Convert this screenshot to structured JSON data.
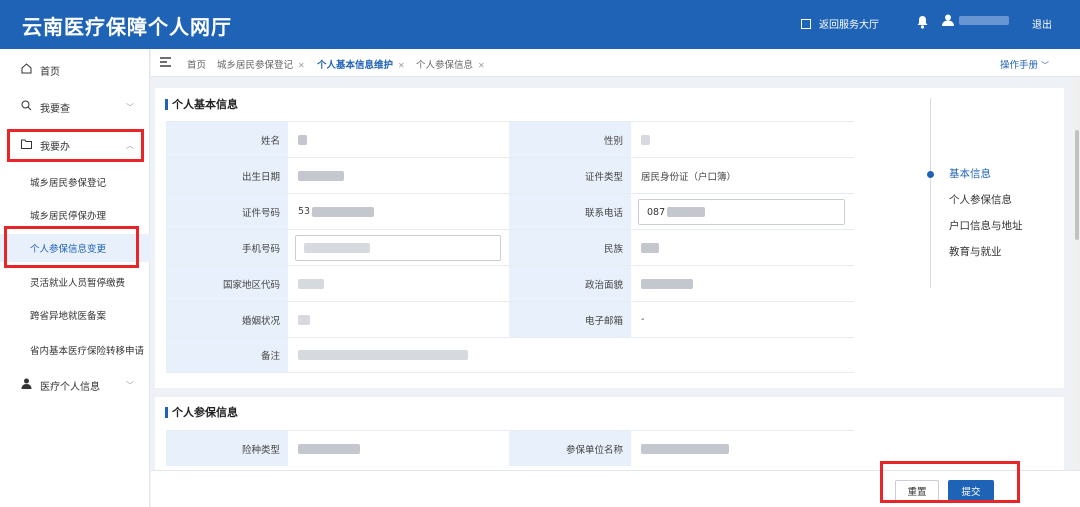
{
  "header": {
    "title": "云南医疗保障个人网厅",
    "return_label": "返回服务大厅",
    "logout_label": "退出"
  },
  "sidebar": {
    "items": [
      {
        "label": "首页",
        "icon": "home-icon"
      },
      {
        "label": "我要查",
        "icon": "search-icon"
      },
      {
        "label": "我要办",
        "icon": "folder-icon"
      },
      {
        "label": "医疗个人信息",
        "icon": "user-icon"
      }
    ],
    "sub_items": [
      "城乡居民参保登记",
      "城乡居民停保办理",
      "个人参保信息变更",
      "灵活就业人员暂停缴费",
      "跨省异地就医备案",
      "省内基本医疗保险转移申请"
    ]
  },
  "tabs": [
    "首页",
    "城乡居民参保登记",
    "个人基本信息维护",
    "个人参保信息"
  ],
  "manual_label": "操作手册",
  "basic_info": {
    "title": "个人基本信息",
    "labels": {
      "name": "姓名",
      "gender": "性别",
      "birth": "出生日期",
      "id_type": "证件类型",
      "id_no": "证件号码",
      "contact": "联系电话",
      "mobile": "手机号码",
      "ethnicity": "民族",
      "country": "国家地区代码",
      "political": "政治面貌",
      "marital": "婚姻状况",
      "email": "电子邮箱",
      "remark": "备注"
    },
    "values": {
      "id_type": "居民身份证（户口簿）",
      "id_no_prefix": "53",
      "contact_prefix": "087",
      "email": "-"
    }
  },
  "insurance_info": {
    "title": "个人参保信息",
    "labels": {
      "type": "险种类型",
      "unit": "参保单位名称"
    }
  },
  "anchor_nav": [
    "基本信息",
    "个人参保信息",
    "户口信息与地址",
    "教育与就业"
  ],
  "buttons": {
    "reset": "重置",
    "submit": "提交"
  },
  "colors": {
    "brand": "#1f63b6",
    "highlight_box": "#e8262a"
  }
}
